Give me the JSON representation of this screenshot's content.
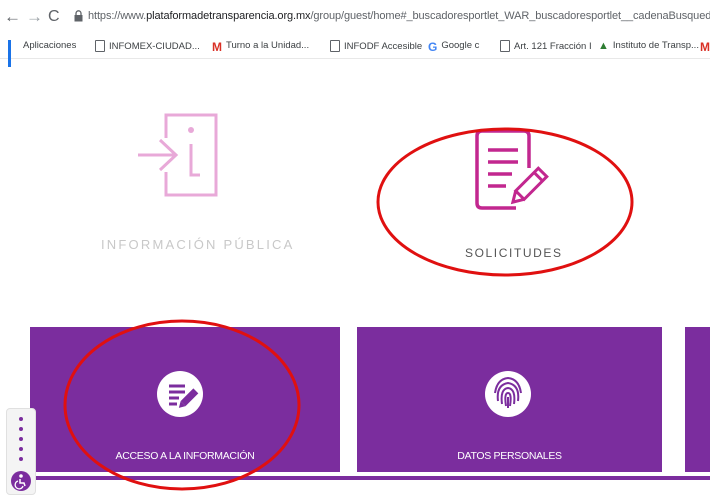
{
  "browser": {
    "url_prefix": "https://www.",
    "url_domain": "plataformadetransparencia.org.mx",
    "url_path": "/group/guest/home#_buscadoresportlet_WAR_buscadoresportlet__cadenaBusqued",
    "bookmarks": [
      {
        "label": "Aplicaciones",
        "icon": "apps-icon"
      },
      {
        "label": "INFOMEX-CIUDAD...",
        "icon": "page-icon"
      },
      {
        "label": "Turno a la Unidad...",
        "icon": "gmail-icon"
      },
      {
        "label": "INFODF Accesible",
        "icon": "page-icon"
      },
      {
        "label": "Google c",
        "icon": "google-icon"
      },
      {
        "label": "Art. 121 Fracción I",
        "icon": "page-icon"
      },
      {
        "label": "Instituto de Transp...",
        "icon": "institution-icon"
      }
    ]
  },
  "tiles": {
    "info_publica": "INFORMACIÓN PÚBLICA",
    "solicitudes": "SOLICITUDES"
  },
  "cards": {
    "acceso": "ACCESO A LA INFORMACIÓN",
    "datos": "DATOS PERSONALES"
  },
  "colors": {
    "brand_purple": "#7b2d9e",
    "muted_pink": "#e8a9d8",
    "magenta": "#c2278f",
    "annotation_red": "#e01010"
  }
}
